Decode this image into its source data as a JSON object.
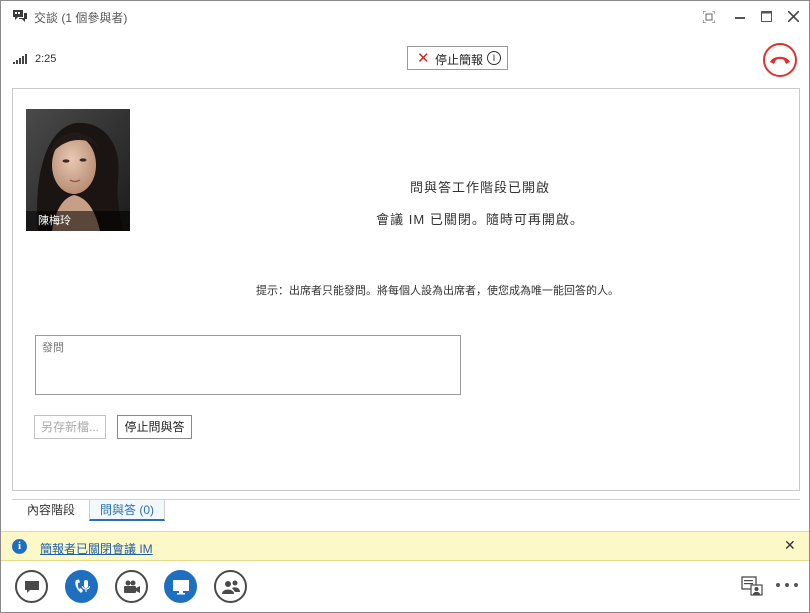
{
  "window": {
    "title": "交談 (1 個參與者)"
  },
  "toolbar": {
    "call_time": "2:25",
    "stop_presenting_label": "停止簡報",
    "stop_presenting_badge": "I"
  },
  "stage": {
    "participant_name": "陳梅玲",
    "message_line1": "問與答工作階段已開啟",
    "message_line2": "會議 IM 已關閉。隨時可再開啟。",
    "hint": "提示：出席者只能發問。將每個人設為出席者，使您成為唯一能回答的人。",
    "ask_placeholder": "發問",
    "save_as_label": "另存新檔...",
    "stop_qa_label": "停止問與答"
  },
  "tabs": [
    {
      "label": "內容階段"
    },
    {
      "label": "問與答 (0)"
    }
  ],
  "notification": {
    "text": "簡報者已關閉會議 IM"
  },
  "colors": {
    "accent_blue": "#1f6fc1",
    "hangup_red": "#e03030",
    "notify_bg": "#fdf8c7"
  }
}
